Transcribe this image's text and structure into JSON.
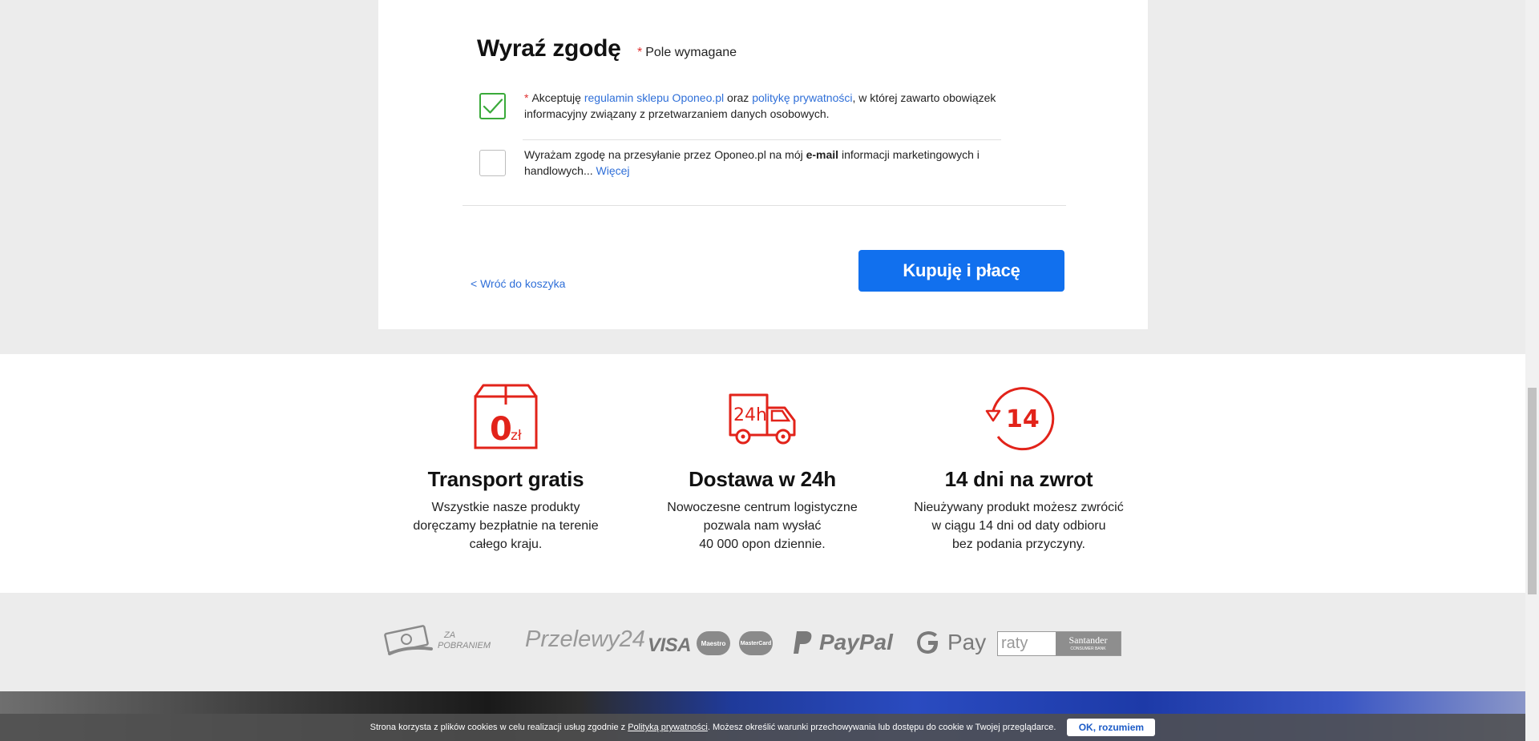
{
  "consent": {
    "title": "Wyraź zgodę",
    "required_star": "*",
    "required_label": "Pole wymagane",
    "items": [
      {
        "checked": true,
        "star": "*",
        "text_1": "Akceptuję ",
        "link_1": "regulamin sklepu Oponeo.pl",
        "text_2": " oraz ",
        "link_2": "politykę prywatności",
        "text_3": ", w której zawarto obowiązek informacyjny związany z przetwarzaniem danych osobowych."
      },
      {
        "checked": false,
        "text_1": "Wyrażam zgodę na przesyłanie przez Oponeo.pl na mój ",
        "bold": "e-mail",
        "text_2": " informacji marketingowych i handlowych... ",
        "link": "Więcej"
      }
    ]
  },
  "actions": {
    "back_label": "< Wróć do koszyka",
    "buy_label": "Kupuję i płacę"
  },
  "features": [
    {
      "icon": "box-free-shipping-icon",
      "icon_big": "0",
      "icon_small": "zł",
      "title": "Transport gratis",
      "desc": "Wszystkie nasze produkty\ndoręczamy bezpłatnie na terenie\ncałego kraju."
    },
    {
      "icon": "delivery-truck-24h-icon",
      "icon_text": "24h",
      "title": "Dostawa w 24h",
      "desc": "Nowoczesne centrum logistyczne\npozwala nam wysłać\n40 000 opon dziennie."
    },
    {
      "icon": "return-14-days-icon",
      "icon_text": "14",
      "title": "14 dni na zwrot",
      "desc": "Nieużywany produkt możesz zwrócić\nw ciągu 14 dni od daty odbioru\nbez podania przyczyny."
    }
  ],
  "payments": {
    "cod_line1": "ZA",
    "cod_line2": "POBRANIEM",
    "przelewy": "Przelewy24",
    "visa": "VISA",
    "maestro": "Maestro",
    "mastercard": "MasterCard",
    "paypal": "PayPal",
    "gpay": "Pay",
    "raty": "raty",
    "santander": "Santander",
    "santander_sub": "CONSUMER BANK"
  },
  "cookie": {
    "text_1": "Strona korzysta z plików cookies w celu realizacji usług zgodnie z ",
    "link": "Polityką prywatności",
    "text_2": ". Możesz określić warunki przechowywania lub dostępu do cookie w Twojej przeglądarce.",
    "ok_label": "OK, rozumiem"
  },
  "colors": {
    "accent_blue": "#1170ee",
    "link_blue": "#2f6fd8",
    "icon_red": "#e2231a",
    "check_green": "#3aaa3a"
  }
}
